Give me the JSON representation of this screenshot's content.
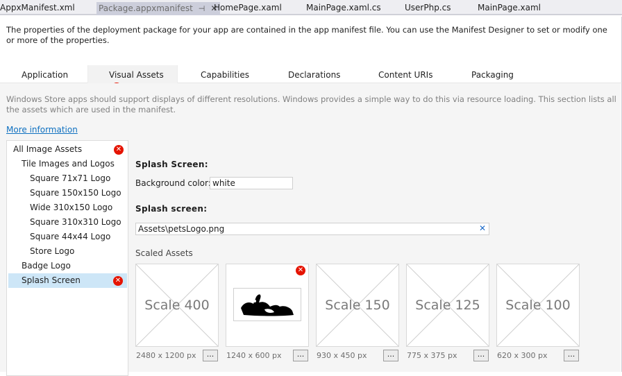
{
  "doc_tabs": [
    {
      "label": "AppxManifest.xml"
    },
    {
      "label": "Package.appxmanifest",
      "active": true
    },
    {
      "label": "HomePage.xaml"
    },
    {
      "label": "MainPage.xaml.cs"
    },
    {
      "label": "UserPhp.cs"
    },
    {
      "label": "MainPage.xaml"
    }
  ],
  "intro": "The properties of the deployment package for your app are contained in the app manifest file. You can use the Manifest Designer to set or modify one or more of the properties.",
  "manifest_tabs": [
    {
      "label": "Application"
    },
    {
      "label": "Visual Assets",
      "active": true,
      "error": true
    },
    {
      "label": "Capabilities"
    },
    {
      "label": "Declarations"
    },
    {
      "label": "Content URIs"
    },
    {
      "label": "Packaging"
    }
  ],
  "description": "Windows Store apps should support displays of different resolutions. Windows provides a simple way to do this via resource loading. This section lists all the assets which are used in the manifest.",
  "more_info": "More information",
  "tree": [
    {
      "label": "All Image Assets",
      "error": true
    },
    {
      "label": "Tile Images and Logos"
    },
    {
      "label": "Square 71x71 Logo"
    },
    {
      "label": "Square 150x150 Logo"
    },
    {
      "label": "Wide 310x150 Logo"
    },
    {
      "label": "Square 310x310 Logo"
    },
    {
      "label": "Square 44x44 Logo"
    },
    {
      "label": "Store Logo"
    },
    {
      "label": "Badge Logo"
    },
    {
      "label": "Splash Screen",
      "error": true,
      "selected": true
    }
  ],
  "splash": {
    "section_title": "Splash Screen:",
    "bg_label": "Background color:",
    "bg_value": "white",
    "image_title": "Splash screen:",
    "image_path": "Assets\\petsLogo.png",
    "scaled_title": "Scaled Assets"
  },
  "assets": [
    {
      "label": "Scale 400",
      "size": "2480 x 1200 px"
    },
    {
      "label": "",
      "size": "1240 x 600 px",
      "error": true,
      "has_image": true
    },
    {
      "label": "Scale 150",
      "size": "930 x 450 px"
    },
    {
      "label": "Scale 125",
      "size": "775 x 375 px"
    },
    {
      "label": "Scale 100",
      "size": "620 x 300 px"
    }
  ],
  "browse_label": "...",
  "error_glyph": "✕",
  "pin_glyph": "⊣",
  "close_glyph": "✕",
  "colors": {
    "error": "#e51400",
    "link": "#0e70c0",
    "selection": "#cde6f7"
  }
}
